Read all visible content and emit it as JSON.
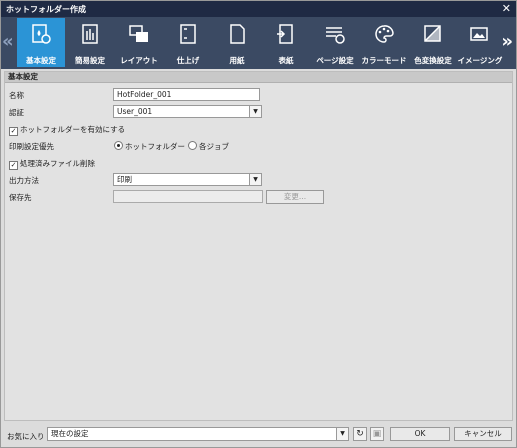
{
  "window": {
    "title": "ホットフォルダー作成"
  },
  "toolbar": {
    "items": [
      {
        "label": "基本設定",
        "icon": "basic-settings-icon"
      },
      {
        "label": "簡易設定",
        "icon": "simple-settings-icon"
      },
      {
        "label": "レイアウト",
        "icon": "layout-icon"
      },
      {
        "label": "仕上げ",
        "icon": "finishing-icon"
      },
      {
        "label": "用紙",
        "icon": "paper-icon"
      },
      {
        "label": "表紙",
        "icon": "cover-icon"
      },
      {
        "label": "ページ設定",
        "icon": "page-settings-icon"
      },
      {
        "label": "カラーモード",
        "icon": "color-mode-icon"
      },
      {
        "label": "色変換設定",
        "icon": "color-conversion-icon"
      },
      {
        "label": "イメージング",
        "icon": "imaging-icon"
      }
    ]
  },
  "section": {
    "title": "基本設定"
  },
  "form": {
    "name_label": "名称",
    "name_value": "HotFolder_001",
    "auth_label": "認証",
    "auth_value": "User_001",
    "enable_label": "ホットフォルダーを有効にする",
    "priority_label": "印刷設定優先",
    "priority_option1": "ホットフォルダー",
    "priority_option2": "各ジョブ",
    "delete_label": "処理済みファイル削除",
    "output_label": "出力方法",
    "output_value": "印刷",
    "save_label": "保存先",
    "change_button": "変更..."
  },
  "footer": {
    "favorites_label": "お気に入り",
    "favorites_value": "現在の設定",
    "ok": "OK",
    "cancel": "キャンセル"
  }
}
